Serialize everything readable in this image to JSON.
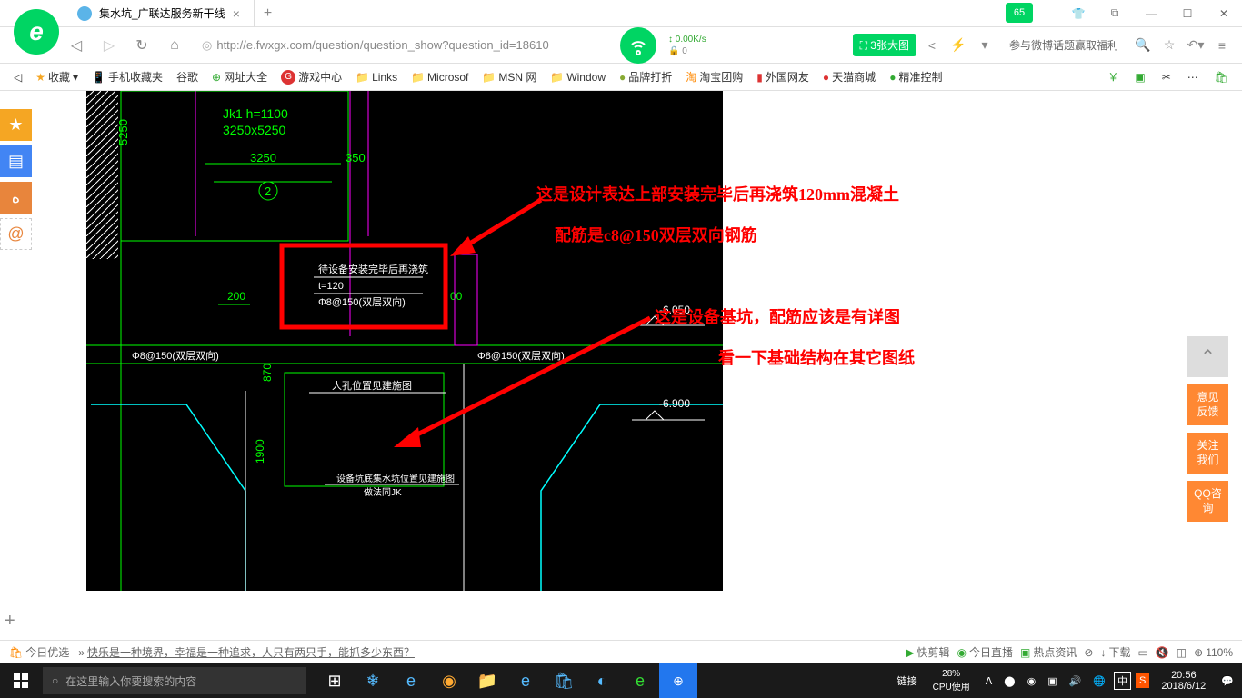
{
  "tab": {
    "title": "集水坑_广联达服务新干线",
    "close": "×",
    "new": "+"
  },
  "score": "65",
  "url": "http://e.fwxgx.com/question/question_show?question_id=18610",
  "speed": {
    "down": "0.00K/s",
    "up": "0"
  },
  "green_button": "⛶ 3张大图",
  "weibo": "参与微博话题赢取福利",
  "bookmarks": {
    "fav": "收藏",
    "items": [
      "手机收藏夹",
      "谷歌",
      "网址大全",
      "游戏中心",
      "Links",
      "Microsof",
      "MSN 网",
      "Window",
      "品牌打折",
      "淘宝团购",
      "外国网友",
      "天猫商城",
      "精准控制"
    ]
  },
  "annotations": {
    "a1": "这是设计表达上部安装完毕后再浇筑120mm混凝土",
    "a2": "配筋是c8@150双层双向钢筋",
    "a3": "这是设备基坑，配筋应该是有详图",
    "a4": "看一下基础结构在其它图纸"
  },
  "cad": {
    "jk": "Jk1  h=1100",
    "dim1": "3250x5250",
    "dim_h": "5250",
    "dim_3250": "3250",
    "dim_350": "350",
    "circle2": "2",
    "box_line1": "待设备安装完毕后再浇筑",
    "box_line2": "t=120",
    "box_line3": "Φ8@150(双层双向)",
    "dim_200": "200",
    "dim_870": "870",
    "dim_1900": "1900",
    "rebar1": "Φ8@150(双层双向)",
    "rebar2": "Φ8@150(双层双向)",
    "label1": "人孔位置见建施图",
    "label2": "设备坑底集水坑位置见建施图",
    "label3": "做法同JK",
    "elev1": "-6.050",
    "elev2": "-6.900",
    "dim_00": "00"
  },
  "right_buttons": {
    "b1": "意见反馈",
    "b2": "关注我们",
    "b3": "QQ咨询"
  },
  "bottom": {
    "today": "今日优选",
    "quote": "快乐是一种境界，幸福是一种追求，人只有两只手，能抓多少东西？",
    "items": [
      "快剪辑",
      "今日直播",
      "热点资讯",
      "",
      "下载",
      "",
      "",
      "",
      "110%"
    ],
    "zoom_icon": "⊕"
  },
  "taskbar": {
    "search_placeholder": "在这里输入你要搜索的内容",
    "link": "链接",
    "cpu_pct": "28%",
    "cpu_label": "CPU使用",
    "ime": "中",
    "time": "20:56",
    "date": "2018/6/12"
  }
}
